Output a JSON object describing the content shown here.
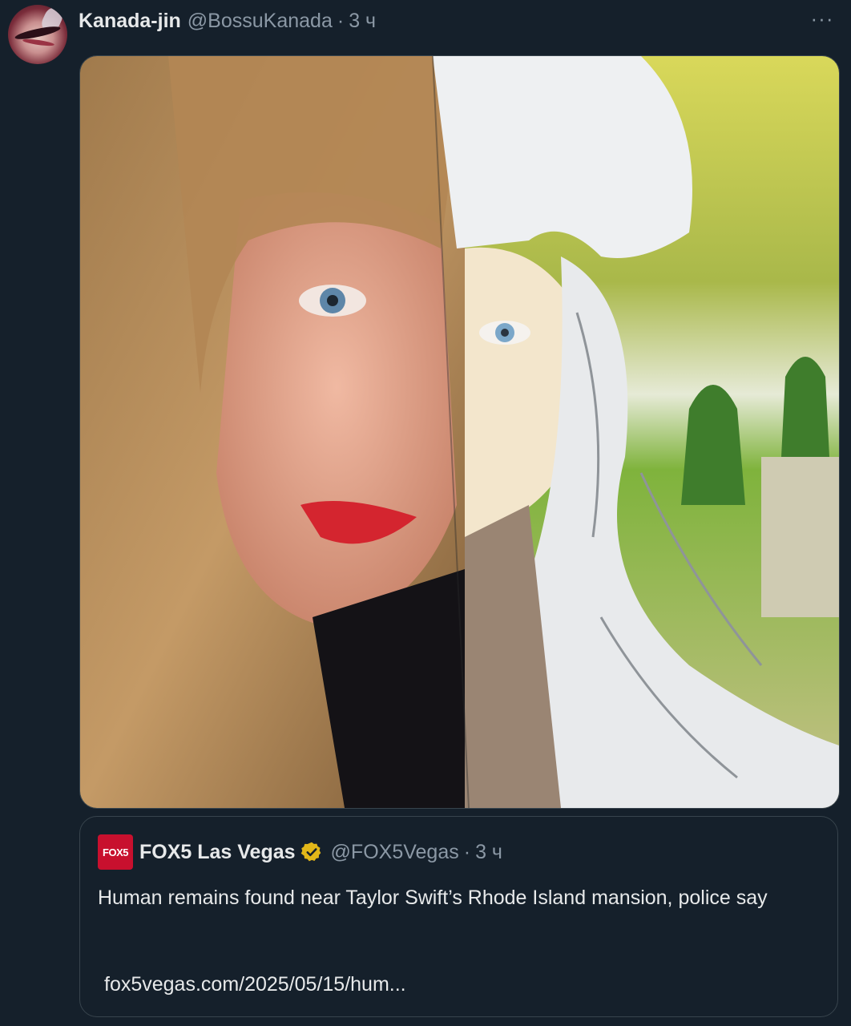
{
  "tweet": {
    "display_name": "Kanada-jin",
    "handle": "@BossuKanada",
    "separator": "·",
    "time": "3 ч",
    "more_label": "···"
  },
  "quote": {
    "logo_text": "FOX5",
    "display_name": "FOX5 Las Vegas",
    "handle": "@FOX5Vegas",
    "separator": "·",
    "time": "3 ч",
    "text": "Human remains found near Taylor Swift’s Rhode Island mansion, police say",
    "link": "fox5vegas.com/2025/05/15/hum..."
  },
  "colors": {
    "background": "#15202b",
    "border": "#38444d",
    "secondary_text": "#8b98a5",
    "verified_gold": "#e2b719",
    "fox_red": "#c8102e"
  },
  "icons": [
    "more-icon",
    "verified-icon",
    "fox5-logo"
  ]
}
